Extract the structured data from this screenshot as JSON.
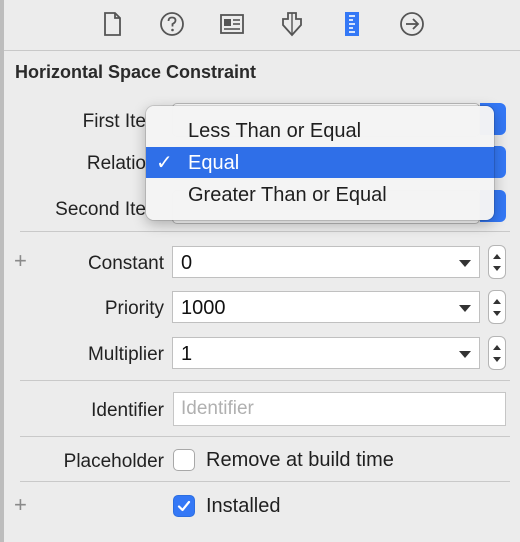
{
  "toolbar": {
    "icons": [
      "file-inspector-icon",
      "help-icon",
      "identity-inspector-icon",
      "attributes-inspector-icon",
      "size-inspector-icon",
      "connections-inspector-icon"
    ]
  },
  "section": {
    "title": "Horizontal Space Constraint"
  },
  "fields": {
    "first_item_label": "First Ite",
    "relation_label": "Relatio",
    "second_item_label": "Second Ite",
    "constant_label": "Constant",
    "constant_value": "0",
    "priority_label": "Priority",
    "priority_value": "1000",
    "multiplier_label": "Multiplier",
    "multiplier_value": "1",
    "identifier_label": "Identifier",
    "identifier_placeholder": "Identifier",
    "placeholder_label": "Placeholder",
    "remove_at_build_time": "Remove at build time",
    "installed_label": "Installed"
  },
  "relation_menu": {
    "items": [
      "Less Than or Equal",
      "Equal",
      "Greater Than or Equal"
    ],
    "selected": "Equal",
    "checkmark": "✓"
  },
  "plus_glyph": "+",
  "colors": {
    "accent": "#3478f6",
    "selection": "#2f6fe8"
  }
}
